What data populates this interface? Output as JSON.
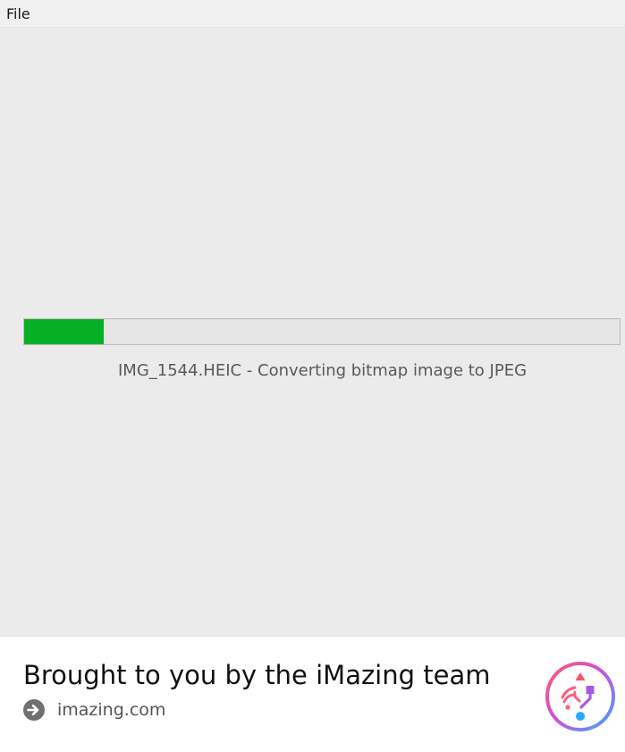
{
  "menubar": {
    "items": [
      {
        "label": "File"
      }
    ]
  },
  "progress": {
    "fraction": 0.133,
    "fill_color": "#06b025",
    "status": "IMG_1544.HEIC - Converting bitmap image to JPEG"
  },
  "footer": {
    "tagline": "Brought to you by the iMazing team",
    "link_icon": "arrow-right-circle-icon",
    "link_text": "imazing.com",
    "logo_icon": "imazing-logo-icon"
  }
}
